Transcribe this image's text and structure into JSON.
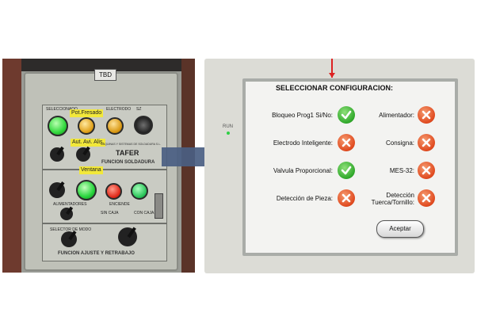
{
  "photo": {
    "tag": "TBD",
    "top_labels": [
      "SELECCIONADO",
      "Pot. Fresado",
      "ELECTRODO",
      "SZ"
    ],
    "yellow_labels": [
      "Pot.Fresado",
      "Aut. Avi. Alis.",
      "Ventana"
    ],
    "brand": "TAFER",
    "brand_sub": "MAQUINAS Y SISTEMAS DE SOLDADURA S.L.",
    "function_1": "FUNCION SOLDADURA",
    "mid_labels": [
      "ALIMENTADORES",
      "ENCIENDE",
      "SIN CAJA",
      "CON CAJA"
    ],
    "bottom_label": "SELECTOR DE MODO",
    "function_2": "FUNCION AJUSTE Y RETRABAJO"
  },
  "panel": {
    "status_label": "RUN",
    "title": "SELECCIONAR CONFIGURACION:",
    "rows": [
      {
        "label": "Bloqueo Prog1 Si/No:",
        "status": "ok"
      },
      {
        "label": "Alimentador:",
        "status": "no"
      },
      {
        "label": "Electrodo Inteligente:",
        "status": "no"
      },
      {
        "label": "Consigna:",
        "status": "no"
      },
      {
        "label": "Valvula Proporcional:",
        "status": "ok"
      },
      {
        "label": "MES-32:",
        "status": "no"
      },
      {
        "label": "Detección de Pieza:",
        "status": "no"
      },
      {
        "label": "Detección Tuerca/Tornillo:",
        "label_lines": [
          "Detección",
          "Tuerca/Tornillo:"
        ],
        "status": "no"
      }
    ],
    "accept_button": "Aceptar"
  },
  "colors": {
    "ok": "#2fa82a",
    "error": "#e0491e",
    "arrow": "#4a5e82",
    "run_led": "#2fcf45"
  }
}
